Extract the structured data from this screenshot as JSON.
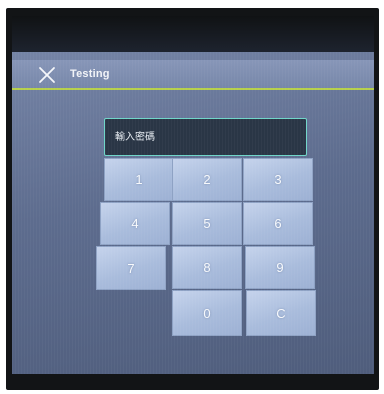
{
  "header": {
    "title": "Testing",
    "close_icon": "close-icon"
  },
  "password": {
    "placeholder": "輸入密碼",
    "value": ""
  },
  "keypad": {
    "keys": [
      "1",
      "2",
      "3",
      "4",
      "5",
      "6",
      "7",
      "8",
      "9",
      "0",
      "C"
    ]
  },
  "colors": {
    "accent_line": "#b6d04c",
    "field_border": "#6fd6c9",
    "field_bg": "#2a3646",
    "key_bg": "#b3c4e2",
    "screen_bg": "#65749a"
  }
}
